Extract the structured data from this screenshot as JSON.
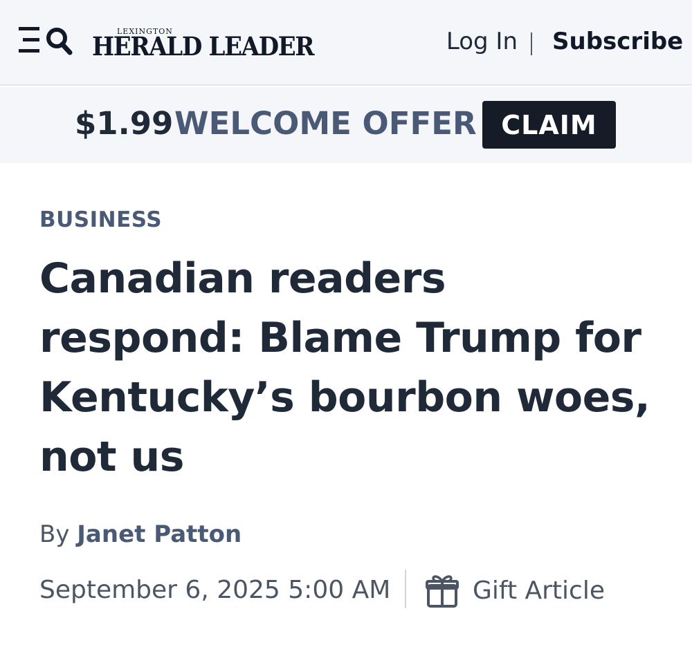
{
  "header": {
    "logo_small": "LEXINGTON",
    "logo_main": "HERALD LEADER",
    "login_label": "Log In",
    "separator": "|",
    "subscribe_label": "Subscribe",
    "menu_icon": "menu-icon",
    "search_icon": "search-icon"
  },
  "offer": {
    "price": "$1.99",
    "text": "WELCOME OFFER",
    "claim_label": "CLAIM"
  },
  "article": {
    "section": "BUSINESS",
    "headline": "Canadian readers respond: Blame Trump for Kentucky’s bourbon woes, not us",
    "byline_prefix": "By",
    "author": "Janet Patton",
    "timestamp": "September 6, 2025 5:00 AM",
    "gift_label": "Gift Article",
    "gift_icon": "gift-icon"
  },
  "colors": {
    "bar_background": "#f4f6fa",
    "accent_slate": "#4a5a76",
    "claim_background": "#151c28",
    "text_dark": "#1f2937"
  }
}
